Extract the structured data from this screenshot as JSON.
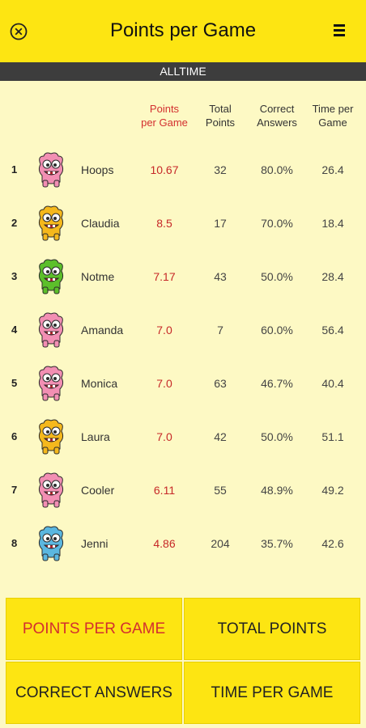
{
  "header": {
    "title": "Points per Game"
  },
  "filter": {
    "label": "ALLTIME"
  },
  "columns": {
    "ppg": [
      "Points",
      "per Game"
    ],
    "total": [
      "Total",
      "Points"
    ],
    "correct": [
      "Correct",
      "Answers"
    ],
    "time": [
      "Time per",
      "Game"
    ]
  },
  "players": [
    {
      "rank": "1",
      "name": "Hoops",
      "ppg": "10.67",
      "total": "32",
      "correct": "80.0%",
      "time": "26.4",
      "monster": "pink"
    },
    {
      "rank": "2",
      "name": "Claudia",
      "ppg": "8.5",
      "total": "17",
      "correct": "70.0%",
      "time": "18.4",
      "monster": "yellow"
    },
    {
      "rank": "3",
      "name": "Notme",
      "ppg": "7.17",
      "total": "43",
      "correct": "50.0%",
      "time": "28.4",
      "monster": "green"
    },
    {
      "rank": "4",
      "name": "Amanda",
      "ppg": "7.0",
      "total": "7",
      "correct": "60.0%",
      "time": "56.4",
      "monster": "pink"
    },
    {
      "rank": "5",
      "name": "Monica",
      "ppg": "7.0",
      "total": "63",
      "correct": "46.7%",
      "time": "40.4",
      "monster": "pink"
    },
    {
      "rank": "6",
      "name": "Laura",
      "ppg": "7.0",
      "total": "42",
      "correct": "50.0%",
      "time": "51.1",
      "monster": "yellow"
    },
    {
      "rank": "7",
      "name": "Cooler",
      "ppg": "6.11",
      "total": "55",
      "correct": "48.9%",
      "time": "49.2",
      "monster": "pink"
    },
    {
      "rank": "8",
      "name": "Jenni",
      "ppg": "4.86",
      "total": "204",
      "correct": "35.7%",
      "time": "42.6",
      "monster": "blue"
    }
  ],
  "buttons": {
    "points_per_game": "POINTS PER GAME",
    "total_points": "TOTAL POINTS",
    "correct_answers": "CORRECT ANSWERS",
    "time_per_game": "TIME PER GAME"
  },
  "colors": {
    "header_bg": "#fde512",
    "page_bg": "#fdf9c4",
    "accent_red": "#d32f2f",
    "filter_bar": "#3d3d3d",
    "monster_pink": "#f28fb3",
    "monster_yellow": "#f5b81c",
    "monster_green": "#5cbf2a",
    "monster_blue": "#5bb7e0"
  },
  "icons": {
    "close": "close-circle-icon",
    "menu": "hamburger-menu-icon"
  }
}
